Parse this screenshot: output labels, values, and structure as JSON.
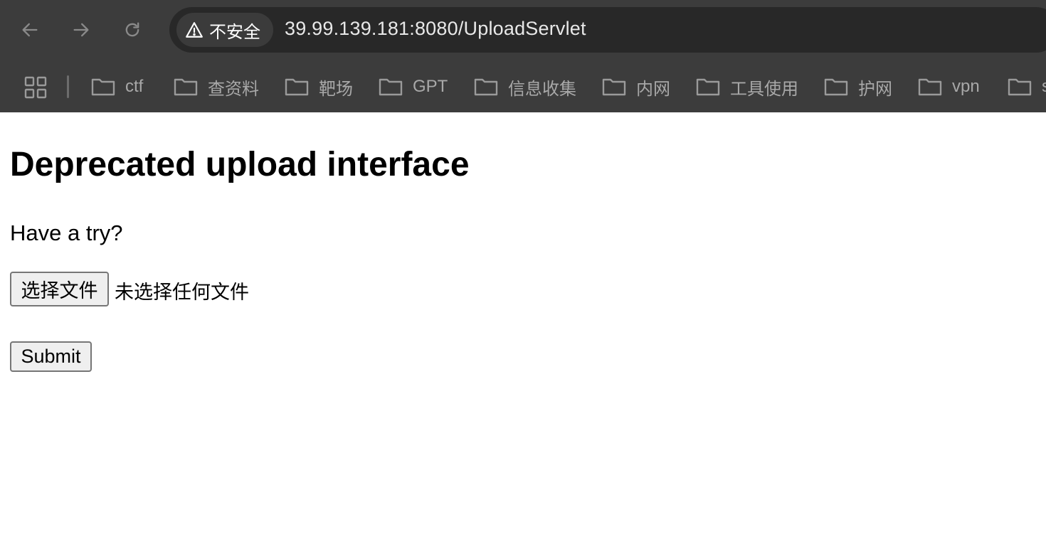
{
  "browser": {
    "security_label": "不安全",
    "url": "39.99.139.181:8080/UploadServlet",
    "bookmarks": [
      {
        "label": "ctf"
      },
      {
        "label": "查资料"
      },
      {
        "label": "靶场"
      },
      {
        "label": "GPT"
      },
      {
        "label": "信息收集"
      },
      {
        "label": "内网"
      },
      {
        "label": "工具使用"
      },
      {
        "label": "护网"
      },
      {
        "label": "vpn"
      },
      {
        "label": "s"
      }
    ]
  },
  "page": {
    "title": "Deprecated upload interface",
    "prompt": "Have a try?",
    "file_button_label": "选择文件",
    "file_status": "未选择任何文件",
    "submit_label": "Submit"
  }
}
